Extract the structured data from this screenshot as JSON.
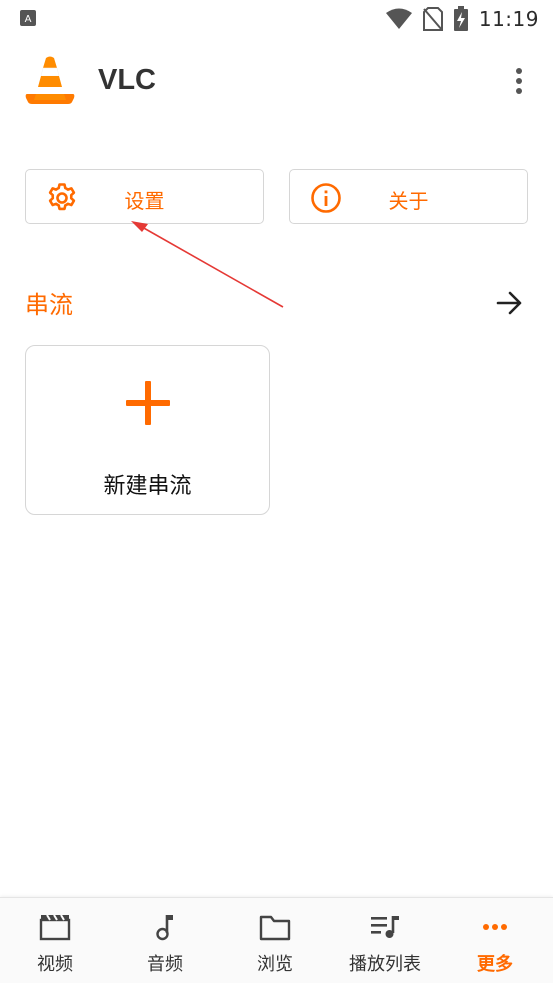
{
  "status_bar": {
    "time": "11:19"
  },
  "app_bar": {
    "title": "VLC"
  },
  "actions": {
    "settings_label": "设置",
    "about_label": "关于"
  },
  "streams": {
    "section_title": "串流",
    "new_stream_label": "新建串流"
  },
  "bottom_nav": {
    "items": [
      {
        "label": "视频",
        "icon": "video-icon"
      },
      {
        "label": "音频",
        "icon": "music-note-icon"
      },
      {
        "label": "浏览",
        "icon": "folder-icon"
      },
      {
        "label": "播放列表",
        "icon": "playlist-icon"
      },
      {
        "label": "更多",
        "icon": "more-dots-icon"
      }
    ],
    "active_index": 4
  },
  "colors": {
    "accent": "#ff6a00",
    "annotation_arrow": "#e53935",
    "text_dark": "#212121"
  }
}
